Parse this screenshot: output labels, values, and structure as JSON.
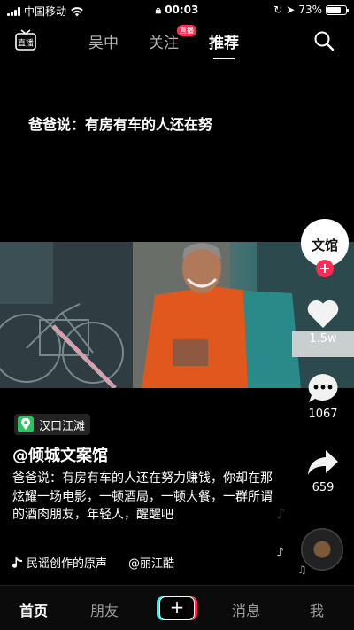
{
  "status_bar": {
    "carrier": "中国移动",
    "time": "00:03",
    "battery": "73%",
    "battery_level": 0.73
  },
  "top_nav": {
    "tabs": [
      {
        "label": "吴中"
      },
      {
        "label": "关注",
        "badge": "直播"
      },
      {
        "label": "推荐",
        "active": true
      }
    ],
    "live_icon_label": "直播"
  },
  "video": {
    "caption": "爸爸说：有房有车的人还在努"
  },
  "rail": {
    "avatar_text": "文馆",
    "likes": "1.5w",
    "comments": "1067",
    "shares": "659"
  },
  "post": {
    "location": "汉口江滩",
    "author": "@倾城文案馆",
    "description": "爸爸说：有房有车的人还在努力赚钱，你却在那炫耀一场电影，一顿酒局，一顿大餐，一群所谓的酒肉朋友，年轻人，醒醒吧",
    "music_text": "民谣创作的原声",
    "music_author": "@丽江酷"
  },
  "bottom_bar": {
    "tabs": [
      {
        "label": "首页",
        "active": true
      },
      {
        "label": "朋友"
      },
      {
        "label": "消息"
      },
      {
        "label": "我"
      }
    ],
    "add_label": "+"
  },
  "colors": {
    "accent": "#fe2c55",
    "cyan": "#25f4ee",
    "location_green": "#2bc463"
  }
}
